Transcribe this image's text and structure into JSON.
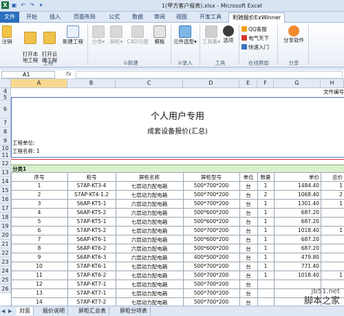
{
  "titlebar": {
    "title": "1(甲方客户报表).xlsx - Microsoft Excel"
  },
  "tabs": [
    "文件",
    "开始",
    "插入",
    "页面布局",
    "公式",
    "数据",
    "审阅",
    "视图",
    "开发工具",
    "利驰报价ExWinner"
  ],
  "ribbon": {
    "logout": "注销",
    "open_local": "打开本\n地工程",
    "open_cloud": "打开云\n端工程",
    "new_project": "新建工程",
    "split": "分类",
    "cabinet": "屏柜",
    "cad_view": "CAD引图",
    "template": "模板",
    "component_select": "元件选型",
    "toolbox": "工具集",
    "options": "选项",
    "qq_service": "QQ客服",
    "elec_world": "电气天下",
    "quick_start": "快速入门",
    "share_software": "分享软件",
    "groups": {
      "project": "工程",
      "new": "①新建",
      "entry": "②录入",
      "tools": "工具",
      "help": "在线帮助",
      "share": "分享"
    }
  },
  "formula": {
    "namebox": "A1",
    "fx": "fx"
  },
  "columns": [
    "A",
    "B",
    "C",
    "D",
    "E",
    "F",
    "G",
    "H"
  ],
  "rows": [
    "4",
    "5",
    "6",
    "7",
    "8",
    "9",
    "10",
    "11",
    "12",
    "13",
    "14",
    "15",
    "16",
    "17",
    "18",
    "19",
    "20",
    "21",
    "22",
    "23",
    "24",
    "25",
    "26"
  ],
  "sheet": {
    "file_no": "文件编号",
    "title": "个人用户专用",
    "subtitle": "成套设备报价(汇总)",
    "project_unit": "工程单位:",
    "project_name": "工程名称: 1",
    "category": "分类1",
    "headers": [
      "序号",
      "柜号",
      "屏柜名称",
      "屏柜型号",
      "单位",
      "数量",
      "单价",
      "总价"
    ],
    "items": [
      [
        "1",
        "S7AP-KT3-4",
        "七层动力配电箱",
        "500*700*200",
        "台",
        "1",
        "1484.40",
        "1"
      ],
      [
        "2",
        "S7AP-KT4-1.2",
        "七层动力配电箱",
        "500*700*200",
        "台",
        "2",
        "1068.40",
        "2"
      ],
      [
        "3",
        "S6AP-KT5-1",
        "六层动力配电箱",
        "500*700*200",
        "台",
        "1",
        "1301.40",
        "1"
      ],
      [
        "4",
        "S6AP-KT5-2",
        "六层动力配电箱",
        "500*600*200",
        "台",
        "1",
        "687.20",
        ""
      ],
      [
        "5",
        "S7AP-KT5-1",
        "七层动力配电箱",
        "500*600*200",
        "台",
        "1",
        "687.20",
        ""
      ],
      [
        "6",
        "S7AP-KT5-2",
        "七层动力配电箱",
        "500*700*200",
        "台",
        "1",
        "1018.40",
        "1"
      ],
      [
        "7",
        "S6AP-KT6-1",
        "六层动力配电箱",
        "500*600*200",
        "台",
        "1",
        "687.20",
        ""
      ],
      [
        "8",
        "S6AP-KT6-2",
        "六层动力配电箱",
        "500*600*200",
        "台",
        "1",
        "687.20",
        ""
      ],
      [
        "9",
        "S6AP-KT6-3",
        "六层动力配电箱",
        "400*500*200",
        "台",
        "1",
        "479.80",
        ""
      ],
      [
        "10",
        "S7AP-KT6-1",
        "七层动力配电箱",
        "500*700*200",
        "台",
        "1",
        "771.40",
        ""
      ],
      [
        "11",
        "S7AP-KT6-2",
        "七层动力配电箱",
        "500*700*200",
        "台",
        "1",
        "1018.40",
        "1"
      ],
      [
        "12",
        "S7AP-KT7-1",
        "七层动力配电箱",
        "500*700*200",
        "台",
        "",
        "",
        ""
      ],
      [
        "13",
        "S7AP-KT7-1",
        "七层动力配电箱",
        "500*700*200",
        "台",
        "",
        "",
        ""
      ],
      [
        "14",
        "S7AP-KT7-2",
        "七层动力配电箱",
        "500*700*200",
        "台",
        "",
        "",
        ""
      ]
    ]
  },
  "sheet_tabs": [
    "封面",
    "报价说明",
    "屏柜汇总表",
    "屏柜分项表"
  ],
  "watermark": {
    "site": "jb51.net",
    "name": "脚本之家"
  },
  "colors": {
    "file_tab": "#2a6ebd",
    "category_fill": "#d9f0cf",
    "border_red": "#e03030"
  }
}
